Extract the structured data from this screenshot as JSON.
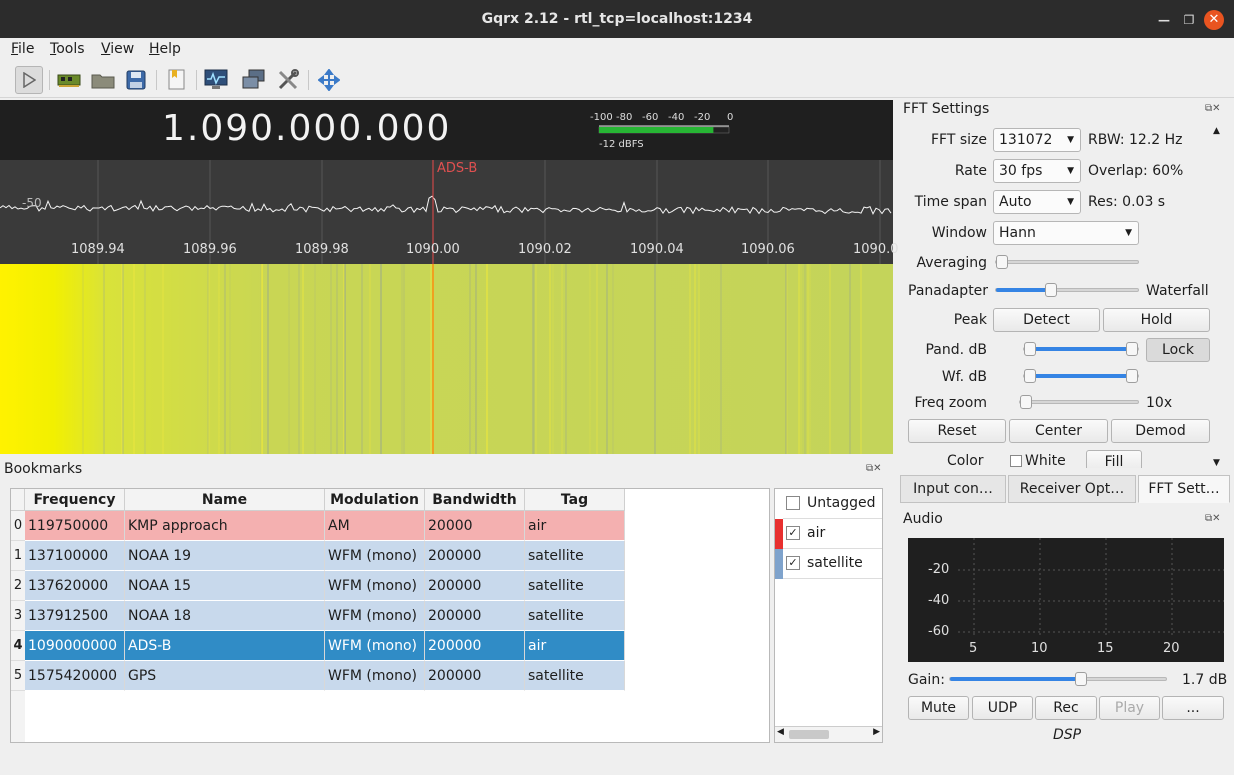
{
  "window": {
    "title": "Gqrx 2.12 - rtl_tcp=localhost:1234"
  },
  "menu": [
    {
      "label": "File",
      "key": "F",
      "rest": "ile"
    },
    {
      "label": "Tools",
      "key": "T",
      "rest": "ools"
    },
    {
      "label": "View",
      "key": "V",
      "rest": "iew"
    },
    {
      "label": "Help",
      "key": "H",
      "rest": "elp"
    }
  ],
  "toolbar": [
    "play-icon",
    "hardware-icon",
    "open-folder-icon",
    "save-icon",
    "bookmark-icon",
    "monitor-icon",
    "network-icon",
    "tools-icon",
    "fullscreen-icon"
  ],
  "frequency": {
    "display": "1.090.000.000"
  },
  "meter": {
    "scale": [
      "-100",
      "-80",
      "-60",
      "-40",
      "-20",
      "0"
    ],
    "level_label": "-12 dBFS",
    "level_fraction": 0.88
  },
  "spectrum": {
    "db_label": "-50",
    "bookmark_marker": "ADS-B",
    "ticks": [
      "1089.94",
      "1089.96",
      "1089.98",
      "1090.00",
      "1090.02",
      "1090.04",
      "1090.06",
      "1090.0"
    ]
  },
  "bookmarks": {
    "title": "Bookmarks",
    "columns": [
      "Frequency",
      "Name",
      "Modulation",
      "Bandwidth",
      "Tag"
    ],
    "rows": [
      {
        "index": "0",
        "frequency": "119750000",
        "name": "KMP approach",
        "modulation": "AM",
        "bandwidth": "20000",
        "tag": "air",
        "color": "#f4b0b0"
      },
      {
        "index": "1",
        "frequency": "137100000",
        "name": "NOAA 19",
        "modulation": "WFM (mono)",
        "bandwidth": "200000",
        "tag": "satellite",
        "color": "#c8d9ec"
      },
      {
        "index": "2",
        "frequency": "137620000",
        "name": "NOAA 15",
        "modulation": "WFM (mono)",
        "bandwidth": "200000",
        "tag": "satellite",
        "color": "#c8d9ec"
      },
      {
        "index": "3",
        "frequency": "137912500",
        "name": "NOAA 18",
        "modulation": "WFM (mono)",
        "bandwidth": "200000",
        "tag": "satellite",
        "color": "#c8d9ec"
      },
      {
        "index": "4",
        "frequency": "1090000000",
        "name": "ADS-B",
        "modulation": "WFM (mono)",
        "bandwidth": "200000",
        "tag": "air",
        "color": "#308cc6",
        "selected": true
      },
      {
        "index": "5",
        "frequency": "1575420000",
        "name": "GPS",
        "modulation": "WFM (mono)",
        "bandwidth": "200000",
        "tag": "satellite",
        "color": "#c8d9ec"
      }
    ],
    "tags": [
      {
        "label": "Untagged",
        "checked": false,
        "color": "#ffffff"
      },
      {
        "label": "air",
        "checked": true,
        "color": "#e8302f"
      },
      {
        "label": "satellite",
        "checked": true,
        "color": "#7fa3cc"
      }
    ]
  },
  "fft": {
    "title": "FFT Settings",
    "fft_size_label": "FFT size",
    "fft_size": "131072",
    "rbw": "RBW: 12.2 Hz",
    "rate_label": "Rate",
    "rate": "30 fps",
    "overlap": "Overlap: 60%",
    "timespan_label": "Time span",
    "timespan": "Auto",
    "res": "Res: 0.03 s",
    "window_label": "Window",
    "window": "Hann",
    "averaging_label": "Averaging",
    "averaging_value": 0.0,
    "panadapter_label": "Panadapter",
    "waterfall_label": "Waterfall",
    "pan_split": 0.38,
    "peak_label": "Peak",
    "detect_btn": "Detect",
    "hold_btn": "Hold",
    "pand_db_label": "Pand. dB",
    "lock_btn": "Lock",
    "wf_db_label": "Wf. dB",
    "freq_zoom_label": "Freq zoom",
    "freq_zoom": "10x",
    "reset_btn": "Reset",
    "center_btn": "Center",
    "demod_btn": "Demod",
    "color_label": "Color",
    "white_label": "White",
    "fill_btn": "Fill"
  },
  "tabs": [
    "Input con…",
    "Receiver Opt…",
    "FFT Sett…"
  ],
  "audio": {
    "title": "Audio",
    "ylabels": [
      "-20",
      "-40",
      "-60"
    ],
    "xlabels": [
      "5",
      "10",
      "15",
      "20"
    ],
    "gain_label": "Gain:",
    "gain_value": "1.7 dB",
    "gain_fraction": 0.6,
    "buttons": [
      "Mute",
      "UDP",
      "Rec",
      "Play",
      "..."
    ],
    "dsp_label": "DSP"
  }
}
